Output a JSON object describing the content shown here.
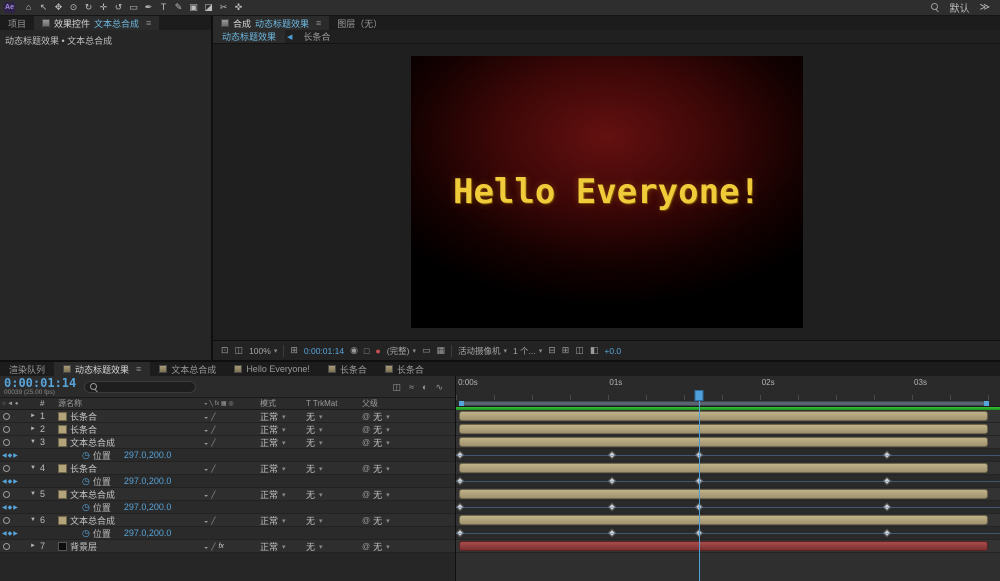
{
  "colors": {
    "accent_blue": "#4f9fd8",
    "value_cyan": "#57a4da",
    "layer_bar_tan": "#b3a47c",
    "background_layer_bar_red": "#9c4444",
    "render_bar_green": "#2db82d",
    "comp_text_yellow": "#f0cc3a"
  },
  "topbar": {
    "logo": "Ae",
    "tools": [
      {
        "name": "home-tool-icon",
        "glyph": "⌂"
      },
      {
        "name": "selection-tool-icon",
        "glyph": "↖"
      },
      {
        "name": "hand-tool-icon",
        "glyph": "✥"
      },
      {
        "name": "zoom-tool-icon",
        "glyph": "⊙"
      },
      {
        "name": "orbit-camera-tool-icon",
        "glyph": "↻"
      },
      {
        "name": "pan-camera-tool-icon",
        "glyph": "✛"
      },
      {
        "name": "rotation-tool-icon",
        "glyph": "↺"
      },
      {
        "name": "shape-tool-icon",
        "glyph": "▭"
      },
      {
        "name": "pen-tool-icon",
        "glyph": "✒"
      },
      {
        "name": "text-tool-icon",
        "glyph": "T"
      },
      {
        "name": "brush-tool-icon",
        "glyph": "✎"
      },
      {
        "name": "clone-stamp-tool-icon",
        "glyph": "▣"
      },
      {
        "name": "eraser-tool-icon",
        "glyph": "◪"
      },
      {
        "name": "roto-brush-tool-icon",
        "glyph": "✂"
      },
      {
        "name": "puppet-tool-icon",
        "glyph": "✜"
      }
    ],
    "workspace": "默认",
    "overflow": "≫"
  },
  "left_panel": {
    "tab_project": "项目",
    "tab_effects": "效果控件",
    "tab_effects_target": "文本总合成",
    "breadcrumb": "动态标题效果 • 文本总合成"
  },
  "comp_panel": {
    "tab_comp": "合成",
    "tab_comp_name": "动态标题效果",
    "tab_layer": "图层（无）",
    "viewer_tab_main": "动态标题效果",
    "viewer_tab_secondary": "长条合",
    "comp_text": "Hello Everyone!"
  },
  "viewer_toolbar": {
    "zoom": "100%",
    "timecode": "0:00:01:14",
    "resolution": "(完整)",
    "view": "活动摄像机",
    "views": "1 个...",
    "exposure": "+0.0"
  },
  "timeline": {
    "tabs": [
      {
        "label": "渲染队列"
      },
      {
        "label": "动态标题效果"
      },
      {
        "label": "文本总合成"
      },
      {
        "label": "Hello Everyone!"
      },
      {
        "label": "长条合"
      },
      {
        "label": "长条合"
      }
    ],
    "timecode": "0:00:01:14",
    "frame_info": "00039 (25.00 fps)",
    "columns": {
      "number": "#",
      "source_name": "源名称",
      "mode": "模式",
      "trkmat": "T TrkMat",
      "parent": "父级"
    },
    "mode_value": "正常",
    "none_value": "无",
    "fx_label": "fx",
    "position_label": "位置",
    "position_value": "297.0,200.0",
    "layers": [
      {
        "num": "1",
        "name": "长条合"
      },
      {
        "num": "2",
        "name": "长条合"
      },
      {
        "num": "3",
        "name": "文本总合成"
      },
      {
        "num": "4",
        "name": "长条合"
      },
      {
        "num": "5",
        "name": "文本总合成"
      },
      {
        "num": "6",
        "name": "文本总合成"
      },
      {
        "num": "7",
        "name": "背景层"
      }
    ],
    "graph": {
      "ruler_labels": [
        {
          "label": "0:00s",
          "pct": 0.4
        },
        {
          "label": "01s",
          "pct": 28.2
        },
        {
          "label": "02s",
          "pct": 56.2
        },
        {
          "label": "03s",
          "pct": 84.2
        }
      ],
      "keyframes_pct": [
        0.8,
        28.6,
        44.6,
        79.3
      ],
      "cti_pct": 44.6,
      "bar_start_pct": 0.5,
      "bar_end_pct": 97.8
    }
  }
}
